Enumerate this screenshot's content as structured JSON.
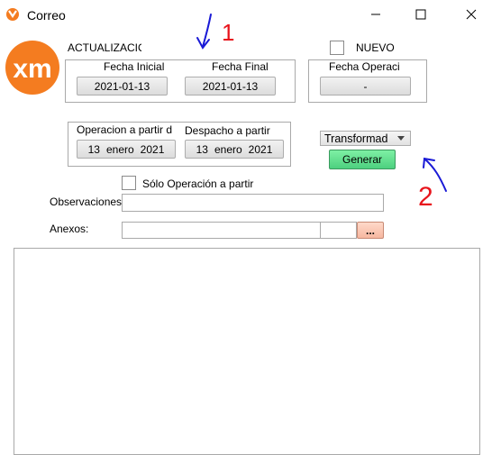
{
  "window": {
    "title": "Correo"
  },
  "header": {
    "actualizacion_label": "ACTUALIZACIO",
    "nuevo_label": "NUEVO"
  },
  "fechas": {
    "inicial_label": "Fecha Inicial",
    "final_label": "Fecha Final",
    "inicial_value": "2021-01-13",
    "final_value": "2021-01-13"
  },
  "fecha_operacion": {
    "label": "Fecha Operaci",
    "value": "-"
  },
  "operacion": {
    "operacion_label": "Operacion a partir d",
    "despacho_label": "Despacho a partir",
    "operacion_day": "13",
    "operacion_month": "enero",
    "operacion_year": "2021",
    "despacho_day": "13",
    "despacho_month": "enero",
    "despacho_year": "2021"
  },
  "transform": {
    "selected": "Transformad"
  },
  "generar_label": "Generar",
  "solo_operacion_label": "Sólo Operación a partir",
  "observaciones": {
    "label": "Observaciones",
    "value": ""
  },
  "anexos": {
    "label": "Anexos:",
    "value": "",
    "browse_label": "..."
  },
  "annotations": {
    "one": "1",
    "two": "2"
  },
  "colors": {
    "logo": "#f47c20",
    "generar": "#5edb8c",
    "browse": "#f9c4b0",
    "annotation_red": "#e8141c",
    "annotation_blue": "#1a1ad6"
  }
}
